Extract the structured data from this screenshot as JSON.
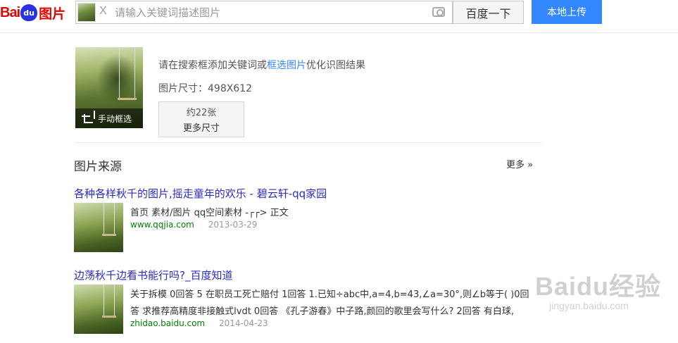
{
  "header": {
    "logo_bai": "Bai",
    "logo_du": "du",
    "logo_pic": "图片",
    "search_clear": "X",
    "search_placeholder": "请输入关键词描述图片",
    "search_button": "百度一下",
    "upload_button": "本地上传"
  },
  "query": {
    "crop_label": "手动框选",
    "hint_before": "请在搜索框添加关键词或",
    "hint_link": "框选图片",
    "hint_after": "优化识图结果",
    "size_text": "图片尺寸：498X612",
    "more_sizes_count": "约22张",
    "more_sizes_label": "更多尺寸"
  },
  "sources": {
    "title": "图片来源",
    "more_label": "更多 »",
    "results": [
      {
        "title": "各种各样秋千的图片,摇走童年的欢乐 - 碧云轩-qq家园",
        "desc": "首页 素材/图片 qq空间素材 -┌┌> 正文",
        "site": "www.qqjia.com",
        "date": "2013-03-29"
      },
      {
        "title": "边荡秋千边看书能行吗?_百度知道",
        "desc": "关于拆模 0回答 5 在职员工死亡赔付 1回答 1.已知÷abc中,a=4,b=43,∠a=30°,则∠b等于( )0回",
        "desc2": "答 求推荐高精度非接触式lvdt 0回答 《孔子游春》中子路,颜回的歌里会写什么? 2回答 有白球,",
        "site": "zhidao.baidu.com",
        "date": "2014-04-23"
      }
    ]
  },
  "watermark": {
    "main": "Baidu经验",
    "sub": "jingyan.baidu.com"
  }
}
